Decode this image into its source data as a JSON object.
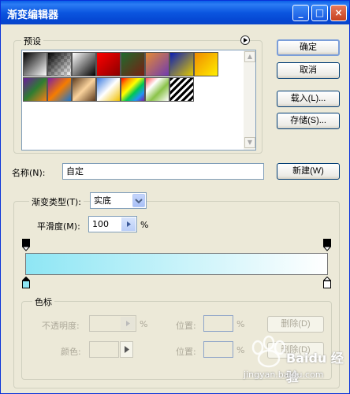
{
  "window": {
    "title": "渐变编辑器"
  },
  "title_buttons": {
    "minimize": "_",
    "maximize": "□",
    "close": "×"
  },
  "presets": {
    "label": "预设"
  },
  "buttons": {
    "ok": "确定",
    "cancel": "取消",
    "load": "载入(L)...",
    "save": "存储(S)...",
    "new": "新建(W)"
  },
  "name_row": {
    "label": "名称(N):",
    "value": "自定"
  },
  "gradient_type": {
    "label": "渐变类型(T):",
    "value": "实底"
  },
  "smoothness": {
    "label": "平滑度(M):",
    "value": "100",
    "unit": "%"
  },
  "color_stops": {
    "label": "色标",
    "opacity_label": "不透明度:",
    "opacity_unit": "%",
    "position_label": "位置:",
    "position_unit": "%",
    "delete_label": "删除(D)",
    "color_label": "颜色:",
    "position2_label": "位置:",
    "position2_unit": "%",
    "delete2_label": "删除(D)"
  },
  "gradient": {
    "start_color": "#8ee6f4",
    "end_color": "#ffffff"
  },
  "watermark": {
    "line1": "Baidu 经验",
    "line2": "jingyan.baidu.com"
  },
  "colors": {
    "title_bar": "#0b56e0",
    "dialog_bg": "#ece9d8",
    "close_red": "#d0492a"
  }
}
